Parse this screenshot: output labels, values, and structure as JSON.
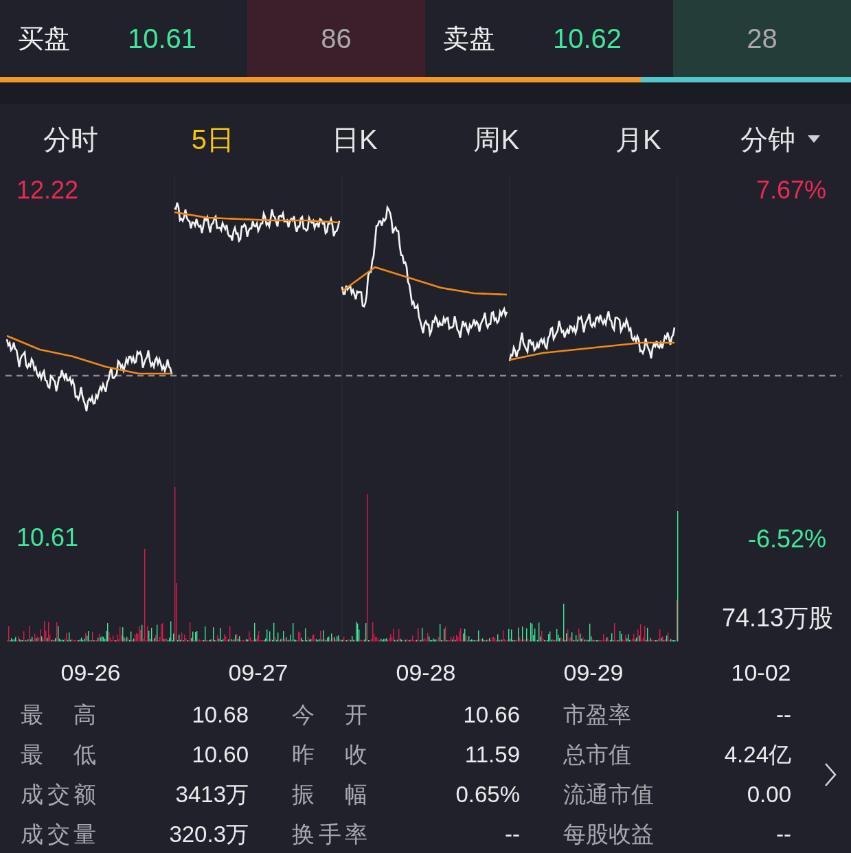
{
  "order_book": {
    "bid": {
      "label": "买盘",
      "price": "10.61",
      "volume": "86"
    },
    "ask": {
      "label": "卖盘",
      "price": "10.62",
      "volume": "28"
    },
    "bid_share": {
      "level": 0.753
    }
  },
  "tabs": [
    {
      "label": "分时",
      "selected": false,
      "kind": "plain"
    },
    {
      "label": "5日",
      "selected": true,
      "kind": "plain"
    },
    {
      "label": "日K",
      "selected": false,
      "kind": "plain"
    },
    {
      "label": "周K",
      "selected": false,
      "kind": "plain"
    },
    {
      "label": "月K",
      "selected": false,
      "kind": "plain"
    },
    {
      "label": "分钟",
      "selected": false,
      "kind": "dropdown"
    }
  ],
  "chart": {
    "high_price": "12.22",
    "high_change": "7.67%",
    "low_price": "10.61",
    "low_change": "-6.52%",
    "max_volume": "74.13万股",
    "dates": [
      "09-26",
      "09-27",
      "09-28",
      "09-29",
      "10-02"
    ]
  },
  "stats": [
    [
      {
        "label": "最 高",
        "value": "10.68"
      },
      {
        "label": "今 开",
        "value": "10.66"
      },
      {
        "label": "市盈率",
        "value": "--"
      }
    ],
    [
      {
        "label": "最 低",
        "value": "10.60"
      },
      {
        "label": "昨 收",
        "value": "11.59"
      },
      {
        "label": "总市值",
        "value": "4.24亿"
      }
    ],
    [
      {
        "label": "成交额",
        "value": "3413万"
      },
      {
        "label": "振 幅",
        "value": "0.65%"
      },
      {
        "label": "流通市值",
        "value": "0.00"
      }
    ],
    [
      {
        "label": "成交量",
        "value": "320.3万"
      },
      {
        "label": "换手率",
        "value": "--"
      },
      {
        "label": "每股收益",
        "value": "--"
      }
    ]
  ]
}
